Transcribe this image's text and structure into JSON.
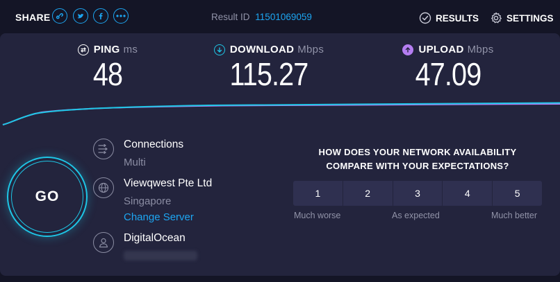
{
  "header": {
    "share_label": "SHARE",
    "share_icons": [
      "link-icon",
      "twitter-icon",
      "facebook-icon",
      "more-icon"
    ],
    "result_id_label": "Result ID",
    "result_id_value": "11501069059",
    "results_label": "RESULTS",
    "settings_label": "SETTINGS"
  },
  "metrics": {
    "ping": {
      "label": "PING",
      "unit": "ms",
      "value": "48",
      "icon": "ping-icon",
      "color": "#ffffff"
    },
    "download": {
      "label": "DOWNLOAD",
      "unit": "Mbps",
      "value": "115.27",
      "icon": "download-icon",
      "color": "#1ec6e6"
    },
    "upload": {
      "label": "UPLOAD",
      "unit": "Mbps",
      "value": "47.09",
      "icon": "upload-icon",
      "color": "#b57ef2"
    }
  },
  "go_label": "GO",
  "info": {
    "connections_title": "Connections",
    "connections_value": "Multi",
    "server_name": "Viewqwest Pte Ltd",
    "server_location": "Singapore",
    "change_server": "Change Server",
    "provider": "DigitalOcean"
  },
  "feedback": {
    "question_line1": "HOW DOES YOUR NETWORK AVAILABILITY",
    "question_line2": "COMPARE WITH YOUR EXPECTATIONS?",
    "options": [
      "1",
      "2",
      "3",
      "4",
      "5"
    ],
    "label_low": "Much worse",
    "label_mid": "As expected",
    "label_high": "Much better"
  },
  "colors": {
    "accent_blue": "#1da6f2",
    "download_line": "#1ec6e6",
    "upload_line": "#b57ef2",
    "panel": "#23243d",
    "background": "#141526"
  }
}
